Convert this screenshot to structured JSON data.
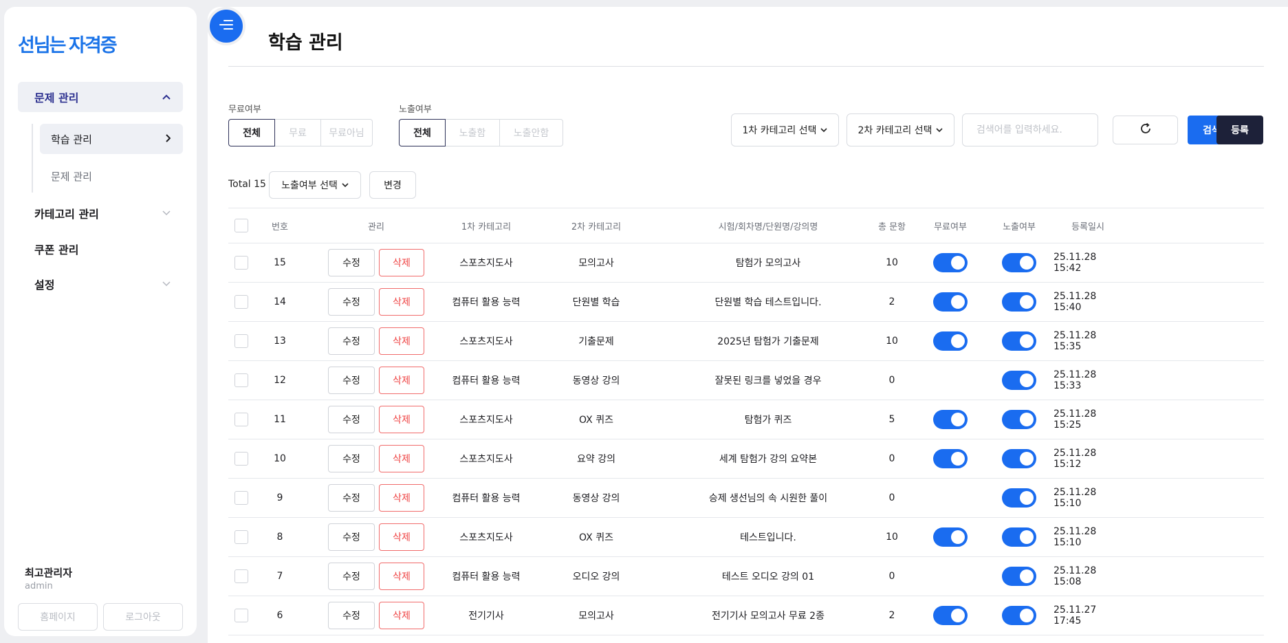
{
  "sidebar": {
    "logo": "선님는 자격증",
    "groups": [
      {
        "label": "문제 관리",
        "expanded": true,
        "items": [
          {
            "label": "학습 관리",
            "active": true
          },
          {
            "label": "문제 관리",
            "active": false
          }
        ]
      },
      {
        "label": "카테고리 관리",
        "expanded": false
      },
      {
        "label": "쿠폰 관리"
      },
      {
        "label": "설정",
        "expanded": false
      }
    ],
    "user": {
      "name": "최고관리자",
      "id": "admin"
    },
    "buttons": {
      "home": "홈페이지",
      "logout": "로그아웃"
    }
  },
  "page": {
    "title": "학습 관리"
  },
  "filters": {
    "free": {
      "label": "무료여부",
      "options": [
        "전체",
        "무료",
        "무료아님"
      ],
      "selected": "전체"
    },
    "exposure": {
      "label": "노출여부",
      "options": [
        "전체",
        "노출함",
        "노출안함"
      ],
      "selected": "전체"
    },
    "category1": "1차 카테고리 선택",
    "category2": "2차 카테고리 선택",
    "search_placeholder": "검색어를 입력하세요.",
    "search_button": "검색",
    "register_button": "등록"
  },
  "bulk": {
    "total": "Total 15",
    "exposure_select": "노출여부 선택",
    "change_button": "변경"
  },
  "table": {
    "columns": [
      "번호",
      "관리",
      "1차 카테고리",
      "2차 카테고리",
      "시험/회차명/단원명/강의명",
      "총 문항",
      "무료여부",
      "노출여부",
      "등록일시"
    ],
    "edit_label": "수정",
    "delete_label": "삭제",
    "rows": [
      {
        "num": "15",
        "cat1": "스포츠지도사",
        "cat2": "모의고사",
        "title": "탐험가 모의고사",
        "count": "10",
        "free": true,
        "exposed": true,
        "date": "25.11.28 15:42"
      },
      {
        "num": "14",
        "cat1": "컴퓨터 활용 능력",
        "cat2": "단원별 학습",
        "title": "단원별 학습 테스트입니다.",
        "count": "2",
        "free": true,
        "exposed": true,
        "date": "25.11.28 15:40"
      },
      {
        "num": "13",
        "cat1": "스포츠지도사",
        "cat2": "기출문제",
        "title": "2025년 탐험가 기출문제",
        "count": "10",
        "free": true,
        "exposed": true,
        "date": "25.11.28 15:35"
      },
      {
        "num": "12",
        "cat1": "컴퓨터 활용 능력",
        "cat2": "동영상 강의",
        "title": "잘못된 링크를 넣었을 경우",
        "count": "0",
        "free": false,
        "exposed": true,
        "date": "25.11.28 15:33"
      },
      {
        "num": "11",
        "cat1": "스포츠지도사",
        "cat2": "OX 퀴즈",
        "title": "탐험가 퀴즈",
        "count": "5",
        "free": true,
        "exposed": true,
        "date": "25.11.28 15:25"
      },
      {
        "num": "10",
        "cat1": "스포츠지도사",
        "cat2": "요약 강의",
        "title": "세계 탐험가 강의 요약본",
        "count": "0",
        "free": true,
        "exposed": true,
        "date": "25.11.28 15:12"
      },
      {
        "num": "9",
        "cat1": "컴퓨터 활용 능력",
        "cat2": "동영상 강의",
        "title": "승제 생선님의 속 시원한 풀이",
        "count": "0",
        "free": false,
        "exposed": true,
        "date": "25.11.28 15:10"
      },
      {
        "num": "8",
        "cat1": "스포츠지도사",
        "cat2": "OX 퀴즈",
        "title": "테스트입니다.",
        "count": "10",
        "free": true,
        "exposed": true,
        "date": "25.11.28 15:10"
      },
      {
        "num": "7",
        "cat1": "컴퓨터 활용 능력",
        "cat2": "오디오 강의",
        "title": "테스트 오디오 강의 01",
        "count": "0",
        "free": false,
        "exposed": true,
        "date": "25.11.28 15:08"
      },
      {
        "num": "6",
        "cat1": "전기기사",
        "cat2": "모의고사",
        "title": "전기기사 모의고사 무료 2종",
        "count": "2",
        "free": true,
        "exposed": true,
        "date": "25.11.27 17:45"
      }
    ]
  },
  "colors": {
    "accent": "#1a6cf0",
    "dark": "#1d2139",
    "danger": "#ef4444"
  }
}
